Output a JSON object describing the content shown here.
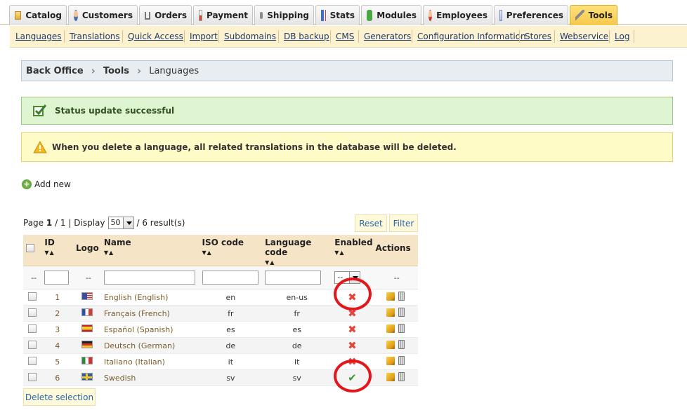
{
  "tabs": [
    {
      "label": "Catalog",
      "icon": "folder-icon"
    },
    {
      "label": "Customers",
      "icon": "person-icon"
    },
    {
      "label": "Orders",
      "icon": "cart-icon"
    },
    {
      "label": "Payment",
      "icon": "payment-icon"
    },
    {
      "label": "Shipping",
      "icon": "truck-icon"
    },
    {
      "label": "Stats",
      "icon": "chart-icon"
    },
    {
      "label": "Modules",
      "icon": "puzzle-icon"
    },
    {
      "label": "Employees",
      "icon": "employee-icon"
    },
    {
      "label": "Preferences",
      "icon": "preferences-icon"
    },
    {
      "label": "Tools",
      "icon": "wrench-icon",
      "active": true
    }
  ],
  "subnav": [
    "Languages",
    "Translations",
    "Quick Access",
    "Import",
    "Subdomains",
    "DB backup",
    "CMS",
    "Generators",
    "Configuration Information",
    "Stores",
    "Webservice",
    "Log"
  ],
  "breadcrumb": {
    "root": "Back Office",
    "section": "Tools",
    "current": "Languages"
  },
  "alerts": {
    "success": "Status update successful",
    "warning": "When you delete a language, all related translations in the database will be deleted."
  },
  "add_new": "Add new",
  "pagination": {
    "page_label": "Page",
    "page": "1",
    "total_pages": "/ 1",
    "display_label": "| Display",
    "per_page": "50",
    "results": "/ 6 result(s)"
  },
  "filter_buttons": {
    "reset": "Reset",
    "filter": "Filter"
  },
  "table": {
    "headers": {
      "id": "ID",
      "logo": "Logo",
      "name": "Name",
      "iso": "ISO code",
      "lang_code": "Language code",
      "enabled": "Enabled",
      "actions": "Actions"
    },
    "filter_placeholders": {
      "dash": "--",
      "enabled_select": "--"
    },
    "rows": [
      {
        "id": "1",
        "name": "English (English)",
        "iso": "en",
        "code": "en-us",
        "enabled": false,
        "flag": "us"
      },
      {
        "id": "2",
        "name": "Français (French)",
        "iso": "fr",
        "code": "fr",
        "enabled": false,
        "flag": "fr"
      },
      {
        "id": "3",
        "name": "Español (Spanish)",
        "iso": "es",
        "code": "es",
        "enabled": false,
        "flag": "es"
      },
      {
        "id": "4",
        "name": "Deutsch (German)",
        "iso": "de",
        "code": "de",
        "enabled": false,
        "flag": "de"
      },
      {
        "id": "5",
        "name": "Italiano (Italian)",
        "iso": "it",
        "code": "it",
        "enabled": false,
        "flag": "it"
      },
      {
        "id": "6",
        "name": "Swedish",
        "iso": "sv",
        "code": "sv",
        "enabled": true,
        "flag": "se"
      }
    ]
  },
  "delete_selection": "Delete selection",
  "colors": {
    "accent_tab": "#f5c84a",
    "success_bg": "#dff5d2",
    "warning_bg": "#fffbc7",
    "annotation_circle": "#e5161b"
  }
}
